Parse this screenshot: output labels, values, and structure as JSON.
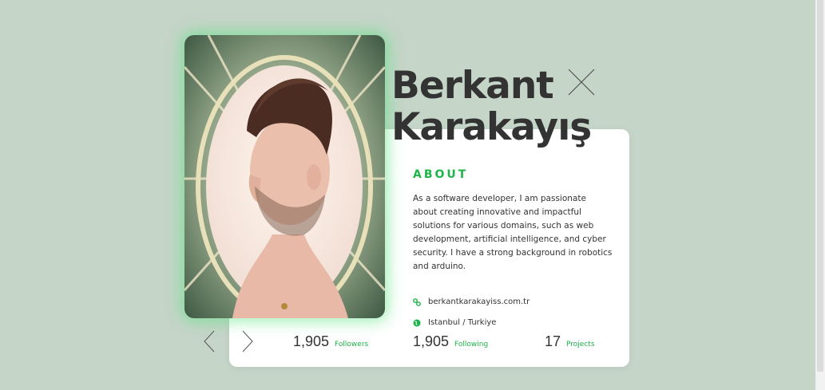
{
  "profile": {
    "first_name": "Berkant",
    "last_name": "Karakayış",
    "about_heading": "ABOUT",
    "about_text": "As a software developer, I am passionate about creating innovative and impactful solutions for various domains, such as web development, artificial intelligence, and cyber security. I have a strong background in robotics and arduino.",
    "website": "berkantkarakayiss.com.tr",
    "location": "Istanbul / Turkiye"
  },
  "stats": [
    {
      "value": "1,905",
      "label": "Followers"
    },
    {
      "value": "1,905",
      "label": "Following"
    },
    {
      "value": "17",
      "label": "Projects"
    }
  ],
  "colors": {
    "background": "#c5d5c8",
    "accent": "#1db44a",
    "text": "#333333",
    "card": "#ffffff",
    "glow": "#4fe278"
  },
  "icons": {
    "close": "close-icon",
    "link": "link-icon",
    "location": "globe-icon",
    "prev": "chevron-left-icon",
    "next": "chevron-right-icon"
  }
}
